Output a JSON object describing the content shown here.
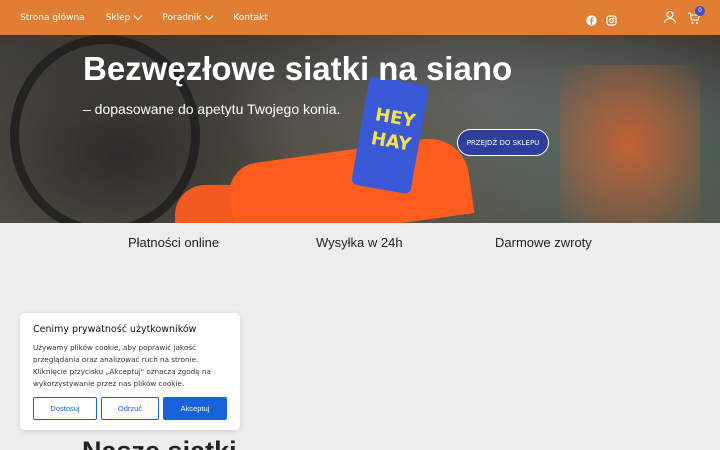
{
  "nav": {
    "items": [
      {
        "label": "Strona główna",
        "dropdown": false
      },
      {
        "label": "Sklep",
        "dropdown": true
      },
      {
        "label": "Poradnik",
        "dropdown": true
      },
      {
        "label": "Kontakt",
        "dropdown": false
      }
    ],
    "cart_count": "0",
    "icons": [
      "facebook-icon",
      "instagram-icon",
      "user-icon",
      "cart-icon"
    ]
  },
  "hero": {
    "title": "Bezwęzłowe siatki na siano",
    "subtitle": "– dopasowane do apetytu Twojego konia.",
    "button": "PRZEJDŹ DO SKLEPU",
    "tag_text": "HEY HAY"
  },
  "features": [
    "Płatności online",
    "Wysyłka w 24h",
    "Darmowe zwroty"
  ],
  "cookie": {
    "title": "Cenimy prywatność użytkowników",
    "text": "Używamy plików cookie, aby poprawić jakość przeglądania oraz analizować ruch na stronie. Kliknięcie przycisku „Akceptuj\" oznacza zgodę na wykorzystywanie przez nas plików cookie.",
    "customize": "Dostosuj",
    "reject": "Odrzuć",
    "accept": "Akceptuj"
  },
  "section_title": "Nasze siatki",
  "colors": {
    "header": "#e07f34",
    "accent": "#1863dc",
    "badge": "#3f4ec2"
  }
}
